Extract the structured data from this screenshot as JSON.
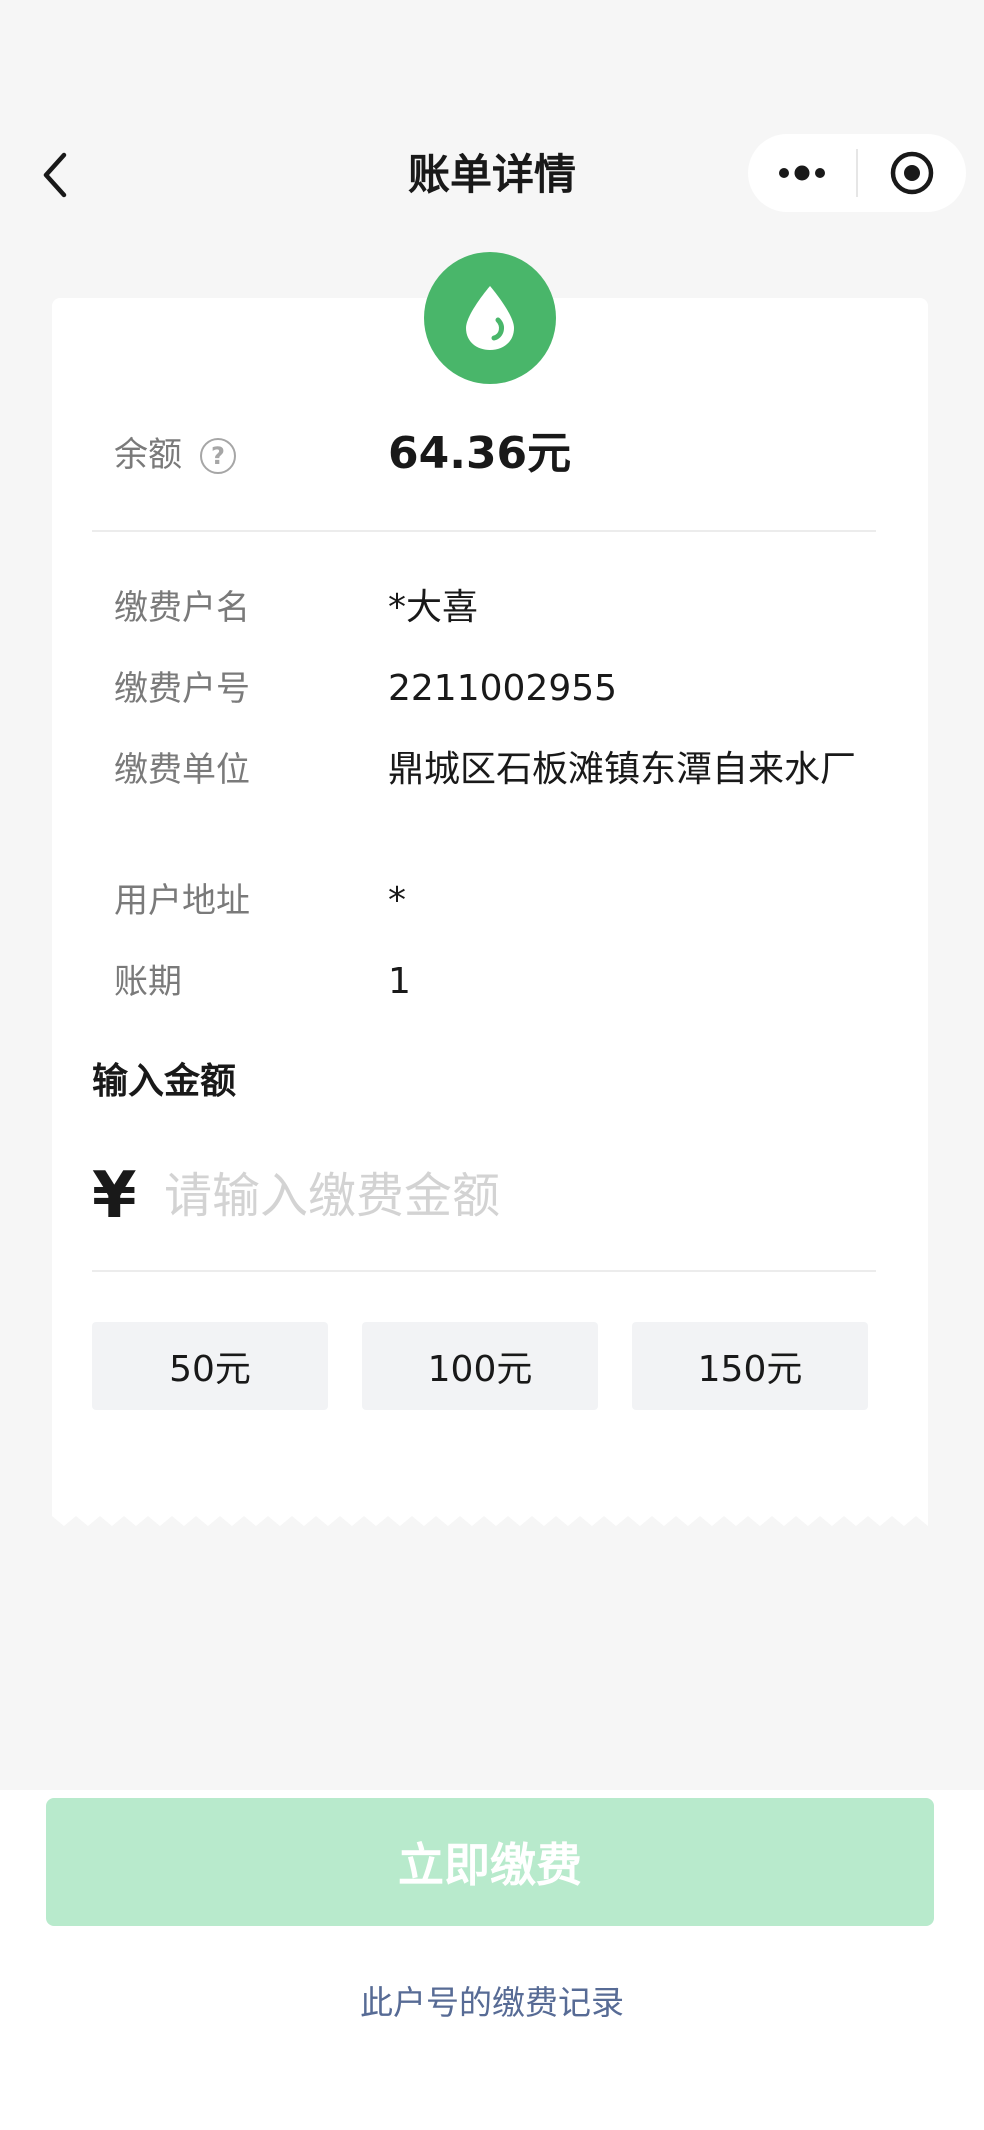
{
  "nav": {
    "title": "账单详情"
  },
  "bill": {
    "balance_label": "余额",
    "help_glyph": "?",
    "balance_value": "64.36元",
    "fields": [
      {
        "label": "缴费户名",
        "value": "*大喜"
      },
      {
        "label": "缴费户号",
        "value": "2211002955"
      },
      {
        "label": "缴费单位",
        "value": "鼎城区石板滩镇东潭自来水厂"
      },
      {
        "label": "用户地址",
        "value": "*"
      },
      {
        "label": "账期",
        "value": "1"
      }
    ]
  },
  "amount": {
    "title": "输入金额",
    "currency_symbol": "¥",
    "placeholder": "请输入缴费金额",
    "presets": [
      "50元",
      "100元",
      "150元"
    ]
  },
  "actions": {
    "pay_label": "立即缴费",
    "record_link": "此户号的缴费记录"
  },
  "colors": {
    "accent_green": "#49b66a",
    "pay_button_disabled": "#b8eacc",
    "link_blue": "#576b95"
  }
}
